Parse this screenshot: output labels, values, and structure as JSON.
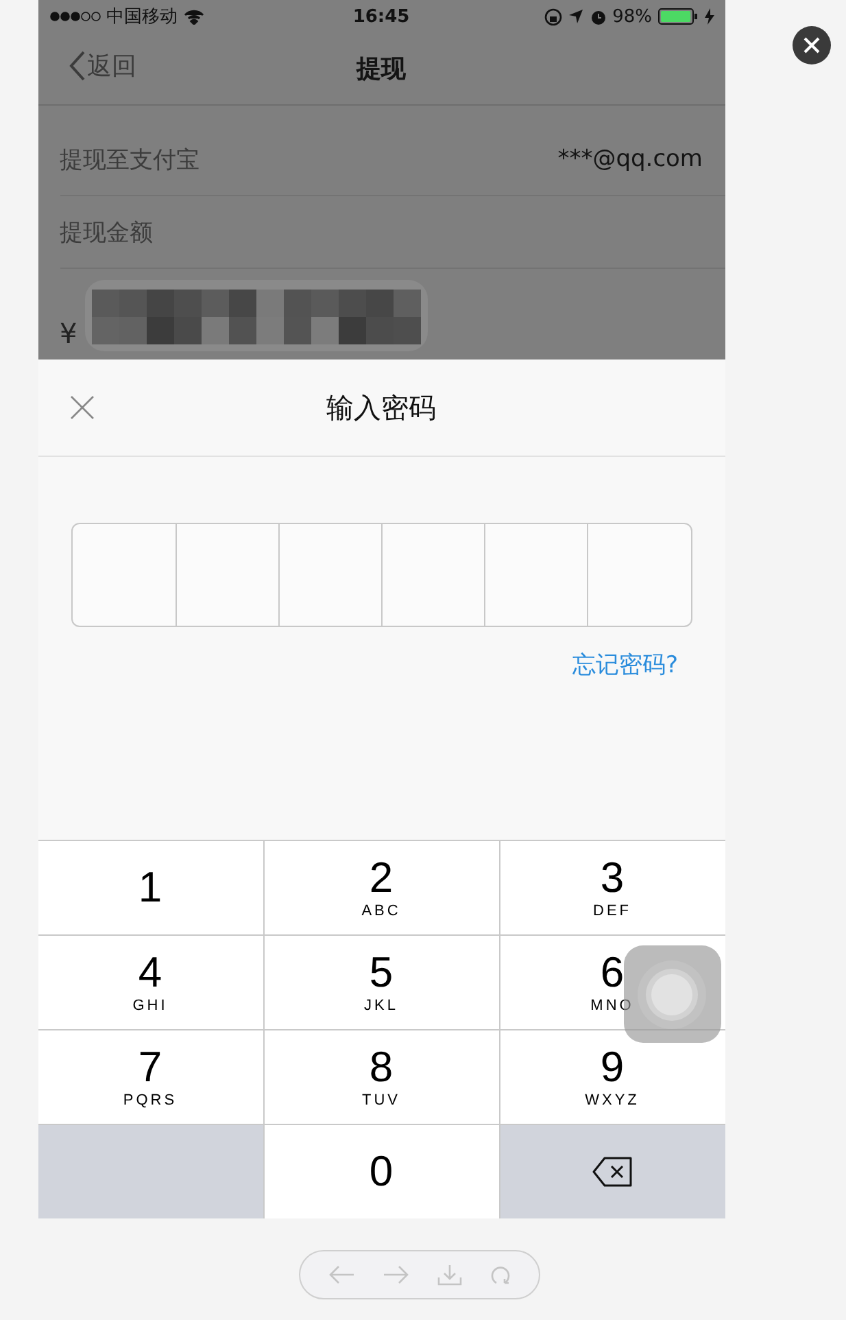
{
  "status_bar": {
    "carrier": "中国移动",
    "time": "16:45",
    "battery": "98%"
  },
  "nav": {
    "back": "返回",
    "title": "提现"
  },
  "rows": [
    {
      "label": "提现至支付宝",
      "value": "***@qq.com"
    },
    {
      "label": "提现金额"
    }
  ],
  "amount": {
    "currency": "¥"
  },
  "dialog": {
    "title": "输入密码",
    "password_cells": [
      {
        "filled": false
      },
      {
        "filled": false
      },
      {
        "filled": false
      },
      {
        "filled": false
      },
      {
        "filled": false
      },
      {
        "filled": false
      }
    ],
    "link": "忘记密码?"
  },
  "keypad": [
    {
      "kind": "digit",
      "digit": "1"
    },
    {
      "kind": "digit",
      "digit": "2",
      "letters": "ABC"
    },
    {
      "kind": "digit",
      "digit": "3",
      "letters": "DEF"
    },
    {
      "kind": "digit",
      "digit": "4",
      "letters": "GHI"
    },
    {
      "kind": "digit",
      "digit": "5",
      "letters": "JKL"
    },
    {
      "kind": "digit",
      "digit": "6",
      "letters": "MNO"
    },
    {
      "kind": "digit",
      "digit": "7",
      "letters": "PQRS"
    },
    {
      "kind": "digit",
      "digit": "8",
      "letters": "TUV"
    },
    {
      "kind": "digit",
      "digit": "9",
      "letters": "WXYZ"
    },
    {
      "kind": "blank"
    },
    {
      "kind": "digit",
      "digit": "0"
    },
    {
      "kind": "delete"
    }
  ]
}
